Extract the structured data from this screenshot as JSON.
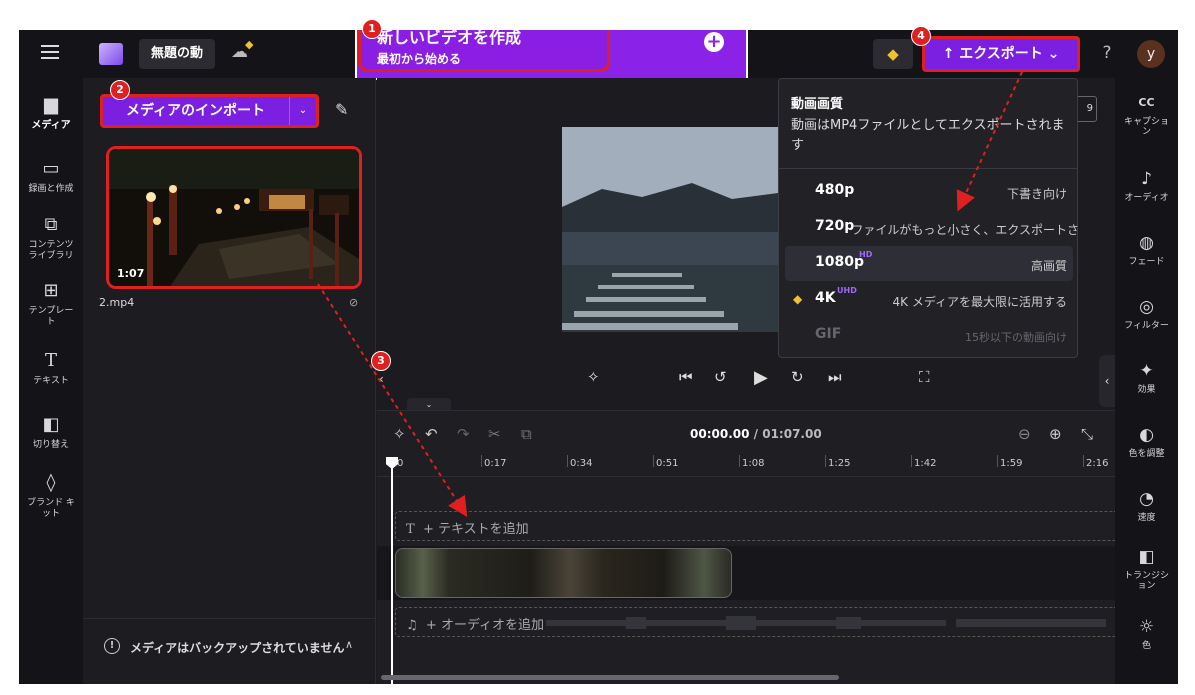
{
  "header": {
    "project_title": "無題の動",
    "new_video_title": "新しいビデオを作成",
    "new_video_subtitle": "最初から始める",
    "export_label": "↑ エクスポート ⌄",
    "help_label": "?",
    "avatar_initial": "y"
  },
  "left_nav": [
    {
      "id": "media",
      "label": "メディア",
      "icon": "folder-icon"
    },
    {
      "id": "record",
      "label": "録画と作成",
      "icon": "camera-icon"
    },
    {
      "id": "content",
      "label": "コンテンツ\nライブラリ",
      "icon": "library-icon"
    },
    {
      "id": "templates",
      "label": "テンプレー\nト",
      "icon": "template-icon"
    },
    {
      "id": "text",
      "label": "テキスト",
      "icon": "text-icon"
    },
    {
      "id": "transitions",
      "label": "切り替え",
      "icon": "transition-icon"
    },
    {
      "id": "brand",
      "label": "ブランド キ\nット",
      "icon": "brand-icon"
    }
  ],
  "media_panel": {
    "import_label": "メディアのインポート",
    "file_duration": "1:07",
    "file_name": "2.mp4",
    "backup_message": "メディアはバックアップされていません"
  },
  "preview": {
    "aspect_label": "9"
  },
  "export_menu": {
    "heading": "動画画質",
    "description": "動画はMP4ファイルとしてエクスポートされます",
    "options": [
      {
        "res": "480p",
        "tag": "",
        "hint": "下書き向け",
        "selected": false,
        "disabled": false,
        "premium": false
      },
      {
        "res": "720p",
        "tag": "",
        "hint": "ファイルがもっと小さく、エクスポートさ",
        "selected": false,
        "disabled": false,
        "premium": false
      },
      {
        "res": "1080p",
        "tag": "HD",
        "hint": "高画質",
        "selected": true,
        "disabled": false,
        "premium": false
      },
      {
        "res": "4K",
        "tag": "UHD",
        "hint": "4K メディアを最大限に活用する",
        "selected": false,
        "disabled": false,
        "premium": true
      },
      {
        "res": "GIF",
        "tag": "",
        "hint": "15秒以下の動画向け",
        "selected": false,
        "disabled": true,
        "premium": false
      }
    ]
  },
  "right_bar": [
    {
      "label": "キャプショ\nン",
      "icon": "captions-icon"
    },
    {
      "label": "オーディオ",
      "icon": "audio-icon"
    },
    {
      "label": "フェード",
      "icon": "fade-icon"
    },
    {
      "label": "フィルター",
      "icon": "filter-icon"
    },
    {
      "label": "効果",
      "icon": "effects-icon"
    },
    {
      "label": "色を調整",
      "icon": "color-adjust-icon"
    },
    {
      "label": "速度",
      "icon": "speed-icon"
    },
    {
      "label": "トランジシ\nョン",
      "icon": "transition-icon"
    },
    {
      "label": "色",
      "icon": "palette-icon"
    }
  ],
  "timeline": {
    "current_time": "00:00.00",
    "total_time": "/ 01:07.00",
    "ticks": [
      "0",
      "0:17",
      "0:34",
      "0:51",
      "1:08",
      "1:25",
      "1:42",
      "1:59",
      "2:16"
    ],
    "add_text": "+ テキストを追加",
    "add_audio": "+ オーディオを追加"
  },
  "annotations": {
    "badges": [
      "1",
      "2",
      "3",
      "4"
    ],
    "accent_color": "#e02020",
    "brand_color": "#7b1fe0"
  }
}
